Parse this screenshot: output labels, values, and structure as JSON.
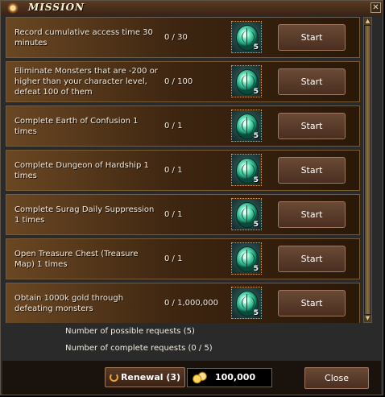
{
  "window": {
    "title": "MISSION"
  },
  "missions": [
    {
      "description": "Record cumulative access time 30 minutes",
      "progress": "0 / 30",
      "reward_count": "5",
      "button": "Start"
    },
    {
      "description": "Eliminate Monsters that are -200 or higher than your character level, defeat 100 of them",
      "progress": "0 / 100",
      "reward_count": "5",
      "button": "Start"
    },
    {
      "description": "Complete Earth of Confusion 1 times",
      "progress": "0 / 1",
      "reward_count": "5",
      "button": "Start"
    },
    {
      "description": "Complete Dungeon of Hardship 1 times",
      "progress": "0 / 1",
      "reward_count": "5",
      "button": "Start"
    },
    {
      "description": "Complete Surag Daily Suppression 1 times",
      "progress": "0 / 1",
      "reward_count": "5",
      "button": "Start"
    },
    {
      "description": "Open Treasure Chest (Treasure Map) 1 times",
      "progress": "0 / 1",
      "reward_count": "5",
      "button": "Start"
    },
    {
      "description": "Obtain 1000k gold through defeating monsters",
      "progress": "0 / 1,000,000",
      "reward_count": "5",
      "button": "Start"
    }
  ],
  "info": {
    "possible_requests": "Number of possible requests (5)",
    "complete_requests": "Number of complete requests (0 / 5)"
  },
  "footer": {
    "renewal_label": "Renewal (3)",
    "gold_amount": "100,000",
    "close_label": "Close"
  },
  "icons": {
    "reward": "green-gem-pouch-icon",
    "renewal": "refresh-icon",
    "gold": "gold-coins-icon"
  }
}
